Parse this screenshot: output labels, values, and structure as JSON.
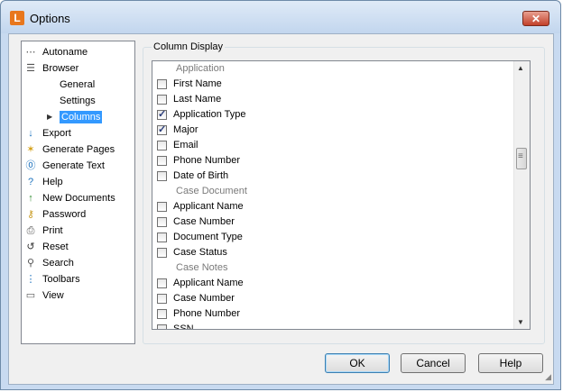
{
  "window": {
    "title": "Options",
    "app_icon": "L",
    "close": "✕"
  },
  "tree": {
    "items": [
      {
        "label": "Autoname",
        "icon": "autoname-icon",
        "glyph": "⋯",
        "color": "#555555"
      },
      {
        "label": "Browser",
        "icon": "browser-icon",
        "glyph": "☰",
        "color": "#555555"
      },
      {
        "label": "Export",
        "icon": "export-icon",
        "glyph": "↓",
        "color": "#1e73be"
      },
      {
        "label": "Generate Pages",
        "icon": "generate-pages-icon",
        "glyph": "✶",
        "color": "#d4a017"
      },
      {
        "label": "Generate Text",
        "icon": "generate-text-icon",
        "glyph": "⓪",
        "color": "#1e73be"
      },
      {
        "label": "Help",
        "icon": "help-icon",
        "glyph": "?",
        "color": "#1e73be"
      },
      {
        "label": "New Documents",
        "icon": "new-documents-icon",
        "glyph": "↑",
        "color": "#2e8b2e"
      },
      {
        "label": "Password",
        "icon": "password-icon",
        "glyph": "⚷",
        "color": "#c89a20"
      },
      {
        "label": "Print",
        "icon": "print-icon",
        "glyph": "⎙",
        "color": "#555555"
      },
      {
        "label": "Reset",
        "icon": "reset-icon",
        "glyph": "↺",
        "color": "#333333"
      },
      {
        "label": "Search",
        "icon": "search-icon",
        "glyph": "⚲",
        "color": "#555555"
      },
      {
        "label": "Toolbars",
        "icon": "toolbars-icon",
        "glyph": "⋮",
        "color": "#1e73be"
      },
      {
        "label": "View",
        "icon": "view-icon",
        "glyph": "▭",
        "color": "#555555"
      }
    ],
    "browser_children": [
      {
        "label": "General"
      },
      {
        "label": "Settings"
      },
      {
        "label": "Columns",
        "selected": true
      }
    ]
  },
  "column_display": {
    "label": "Column Display",
    "rows": [
      {
        "type": "header",
        "label": "Application"
      },
      {
        "type": "check",
        "label": "First Name",
        "checked": false
      },
      {
        "type": "check",
        "label": "Last Name",
        "checked": false
      },
      {
        "type": "check",
        "label": "Application Type",
        "checked": true
      },
      {
        "type": "check",
        "label": "Major",
        "checked": true
      },
      {
        "type": "check",
        "label": "Email",
        "checked": false
      },
      {
        "type": "check",
        "label": "Phone Number",
        "checked": false
      },
      {
        "type": "check",
        "label": "Date of Birth",
        "checked": false
      },
      {
        "type": "header",
        "label": "Case Document"
      },
      {
        "type": "check",
        "label": "Applicant Name",
        "checked": false
      },
      {
        "type": "check",
        "label": "Case Number",
        "checked": false
      },
      {
        "type": "check",
        "label": "Document Type",
        "checked": false
      },
      {
        "type": "check",
        "label": "Case Status",
        "checked": false
      },
      {
        "type": "header",
        "label": "Case Notes"
      },
      {
        "type": "check",
        "label": "Applicant Name",
        "checked": false
      },
      {
        "type": "check",
        "label": "Case Number",
        "checked": false
      },
      {
        "type": "check",
        "label": "Phone Number",
        "checked": false
      },
      {
        "type": "check",
        "label": "SSN",
        "checked": false
      }
    ]
  },
  "buttons": {
    "ok": "OK",
    "cancel": "Cancel",
    "help": "Help"
  },
  "colors": {
    "selection": "#3399ff",
    "app_icon": "#e8771d",
    "close_button": "#c2402a"
  }
}
